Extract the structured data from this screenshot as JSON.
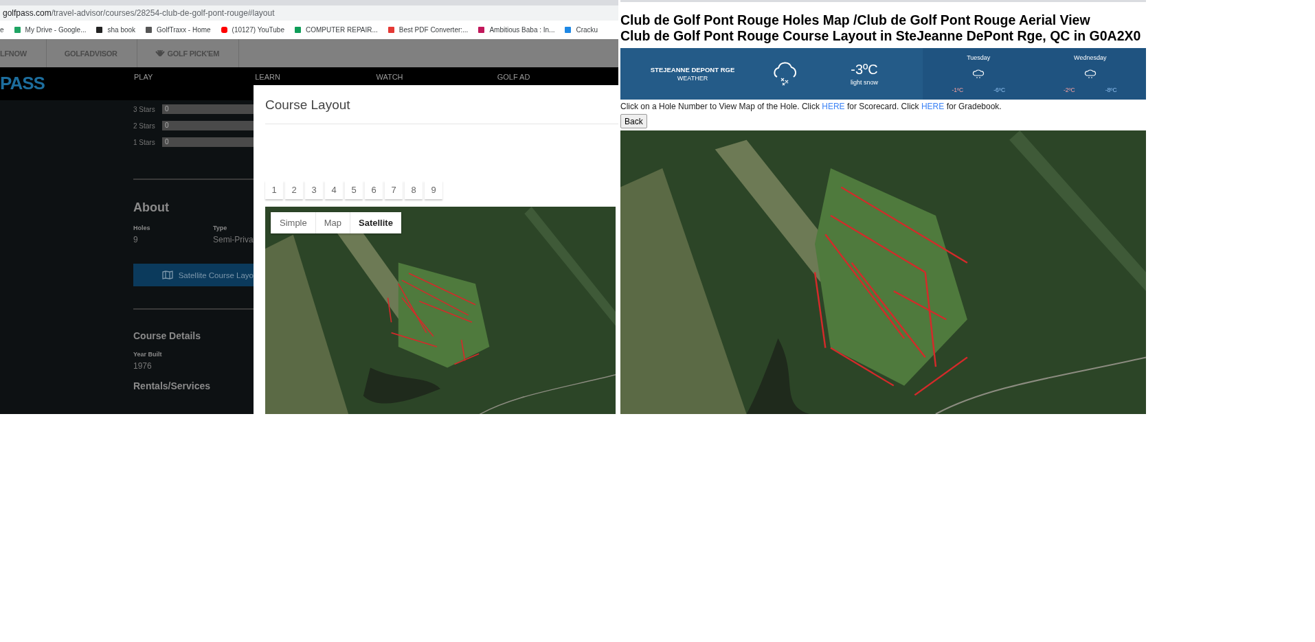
{
  "left_screenshot": {
    "address_bar": {
      "domain": "golfpass.com",
      "path": "/travel-advisor/courses/28254-club-de-golf-pont-rouge#layout"
    },
    "bookmarks": [
      {
        "label": "e",
        "kind": "none"
      },
      {
        "label": "My Drive - Google...",
        "kind": "drive"
      },
      {
        "label": "sha book",
        "kind": "golfer"
      },
      {
        "label": "GolfTraxx - Home",
        "kind": "cart"
      },
      {
        "label": "(10127) YouTube",
        "kind": "video"
      },
      {
        "label": "COMPUTER REPAIR...",
        "kind": "sheet"
      },
      {
        "label": "Best PDF Converter:...",
        "kind": "pdf"
      },
      {
        "label": "Ambitious Baba : In...",
        "kind": "link"
      },
      {
        "label": "Cracku",
        "kind": "doc"
      }
    ],
    "network_nav": [
      {
        "label": "LFNOW",
        "kind": "text"
      },
      {
        "label": "GOLFADVISOR",
        "kind": "text"
      },
      {
        "label": "GOLF PICK'EM",
        "kind": "peacock"
      }
    ],
    "logo": "PASS",
    "main_nav": [
      "PLAY",
      "LEARN",
      "WATCH",
      "GOLF AD"
    ],
    "ratings": [
      {
        "label": "3 Stars",
        "count": "0"
      },
      {
        "label": "2 Stars",
        "count": "0"
      },
      {
        "label": "1 Stars",
        "count": "0"
      }
    ],
    "about": {
      "heading": "About",
      "facts": [
        {
          "label": "Holes",
          "value": "9"
        },
        {
          "label": "Type",
          "value": "Semi-Priva"
        }
      ]
    },
    "layout_button": "Satellite Course Layo",
    "course_details": {
      "heading": "Course Details",
      "facts": [
        {
          "label": "Year Built",
          "value": "1976"
        }
      ]
    },
    "rentals_heading": "Rentals/Services",
    "modal": {
      "title": "Course Layout",
      "holes": [
        "1",
        "2",
        "3",
        "4",
        "5",
        "6",
        "7",
        "8",
        "9"
      ],
      "map_types": [
        {
          "label": "Simple",
          "selected": false
        },
        {
          "label": "Map",
          "selected": false
        },
        {
          "label": "Satellite",
          "selected": true
        }
      ]
    }
  },
  "right_screenshot": {
    "title_lines": [
      "Club de Golf Pont Rouge Holes Map /Club de Golf Pont Rouge Aerial View",
      "Club de Golf Pont Rouge Course Layout in SteJeanne DePont Rge, QC in G0A2X0"
    ],
    "weather": {
      "location": "STEJEANNE DEPONT RGE",
      "label": "WEATHER",
      "temperature": "-3ºC",
      "condition": "light snow",
      "forecast": [
        {
          "day": "Tuesday",
          "high": "-1ºC",
          "low": "-6ºC"
        },
        {
          "day": "Wednesday",
          "high": "-2ºC",
          "low": "-8ºC"
        }
      ]
    },
    "instructions": [
      {
        "kind": "text",
        "text": "Click on a Hole Number to View Map of the Hole. Click "
      },
      {
        "kind": "link",
        "text": "HERE"
      },
      {
        "kind": "text",
        "text": " for Scorecard. Click "
      },
      {
        "kind": "link",
        "text": "HERE"
      },
      {
        "kind": "text",
        "text": " for Gradebook."
      }
    ],
    "back_button": "Back"
  }
}
